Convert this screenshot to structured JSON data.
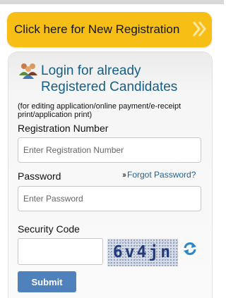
{
  "new_registration": {
    "label": "Click here for New Registration",
    "icon": "double-chevron-right-icon",
    "color": "#f7bf16"
  },
  "login": {
    "icon": "users-icon",
    "title": "Login for already Registered Candidates",
    "note": "(for editing application/online payment/e-receipt print/application print)",
    "title_color": "#155f84"
  },
  "registration_number": {
    "label": "Registration Number",
    "placeholder": "Enter Registration Number"
  },
  "password": {
    "label": "Password",
    "placeholder": "Enter Password",
    "forgot_link": "Forgot Password?"
  },
  "security_code": {
    "label": "Security Code",
    "captcha_text": "6v4jn",
    "refresh_icon": "refresh-icon"
  },
  "submit": {
    "label": "Submit",
    "color": "#4f82bd"
  }
}
